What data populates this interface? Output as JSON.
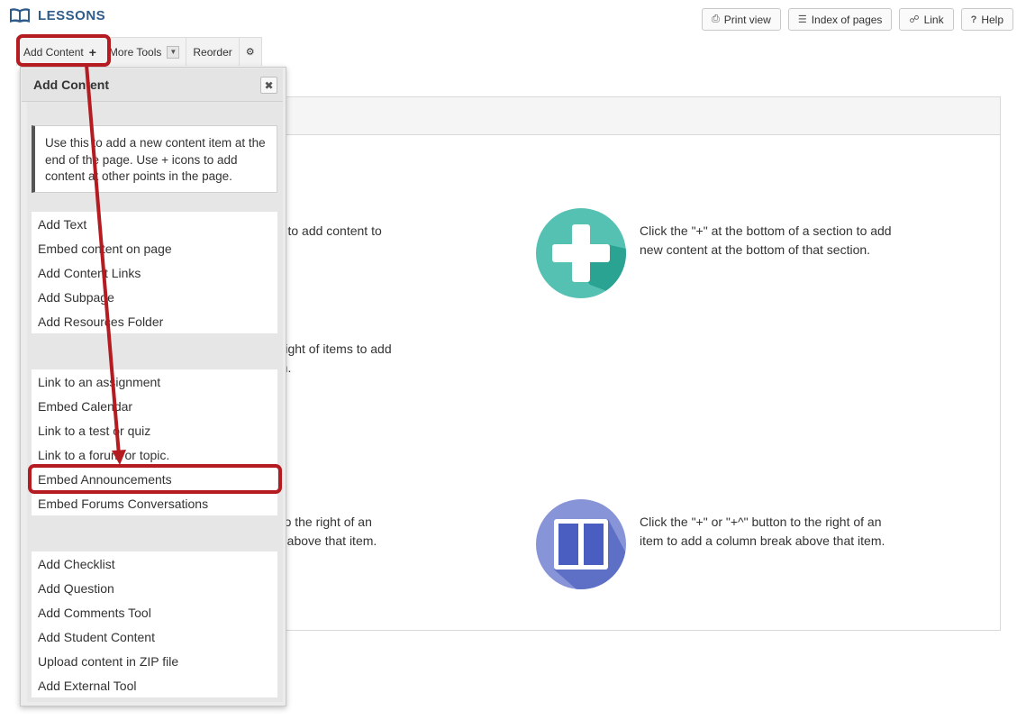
{
  "header": {
    "title": "LESSONS",
    "buttons": {
      "print": "Print view",
      "index": "Index of pages",
      "link": "Link",
      "help": "Help"
    }
  },
  "toolbar": {
    "add_content": "Add Content",
    "more_tools": "More Tools",
    "reorder": "Reorder"
  },
  "background": {
    "left1": [
      "ab to add content to"
    ],
    "left2": [
      "e right of items to add",
      "em."
    ],
    "left3": [
      "n to the right of an",
      "ak above that item."
    ],
    "right1": [
      "Click the \"+\" at the bottom of a section to add",
      "new content at the bottom of that section."
    ],
    "right2": [
      "Click the \"+\" or \"+^\" button to the right of an",
      "item to add a column break above that item."
    ]
  },
  "panel": {
    "title": "Add Content",
    "info": "Use this to add a new content item at the end of the page. Use + icons to add content at other points in the page.",
    "group1": [
      "Add Text",
      "Embed content on page",
      "Add Content Links",
      "Add Subpage",
      "Add Resources Folder"
    ],
    "group2": [
      "Link to an assignment",
      "Embed Calendar",
      "Link to a test or quiz",
      "Link to a forum or topic.",
      "Embed Announcements",
      "Embed Forums Conversations"
    ],
    "group3": [
      "Add Checklist",
      "Add Question",
      "Add Comments Tool",
      "Add Student Content",
      "Upload content in ZIP file",
      "Add External Tool"
    ]
  },
  "colors": {
    "accent_teal": "#4fc0b2",
    "accent_blue": "#7b8bd6",
    "highlight_red": "#b51c22",
    "title_blue": "#2f5c8a"
  }
}
